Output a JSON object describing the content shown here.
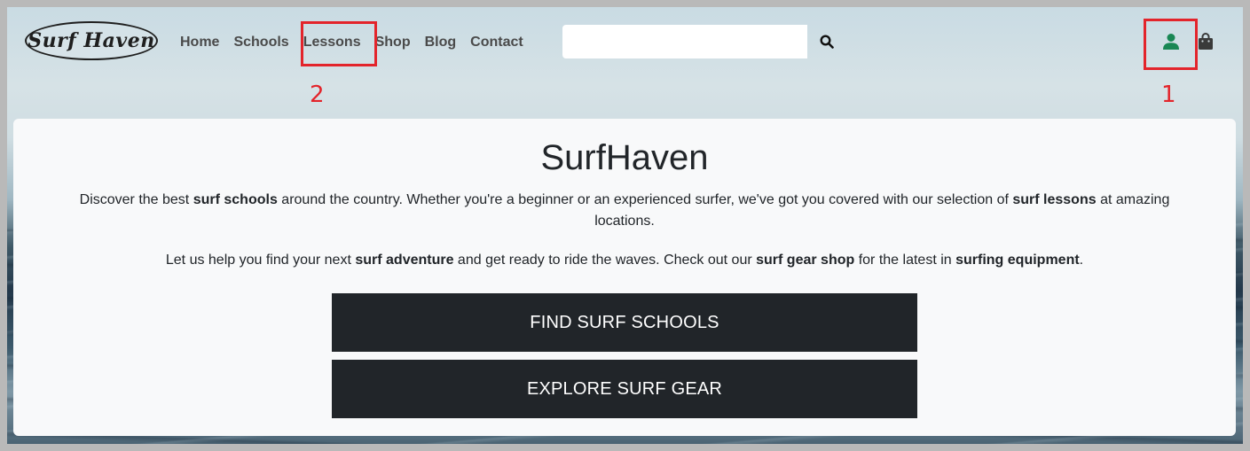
{
  "brand": {
    "logo_text": "Surf Haven"
  },
  "nav": {
    "links": [
      "Home",
      "Schools",
      "Lessons",
      "Shop",
      "Blog",
      "Contact"
    ]
  },
  "search": {
    "value": "",
    "placeholder": "",
    "icon": "search-icon"
  },
  "header_icons": {
    "account": "user-icon",
    "cart": "shopping-bag-icon",
    "account_color": "#198754"
  },
  "annotations": {
    "label_1": "1",
    "label_2": "2",
    "color": "#e3242b"
  },
  "hero": {
    "title": "SurfHaven",
    "p1": {
      "t1": "Discover the best ",
      "b1": "surf schools",
      "t2": " around the country. Whether you're a beginner or an experienced surfer, we've got you covered with our selection of ",
      "b2": "surf lessons",
      "t3": " at amazing locations."
    },
    "p2": {
      "t1": "Let us help you find your next ",
      "b1": "surf adventure",
      "t2": " and get ready to ride the waves. Check out our ",
      "b2": "surf gear shop",
      "t3": " for the latest in ",
      "b3": "surfing equipment",
      "t4": "."
    },
    "buttons": {
      "schools": "FIND SURF SCHOOLS",
      "gear": "EXPLORE SURF GEAR"
    }
  }
}
